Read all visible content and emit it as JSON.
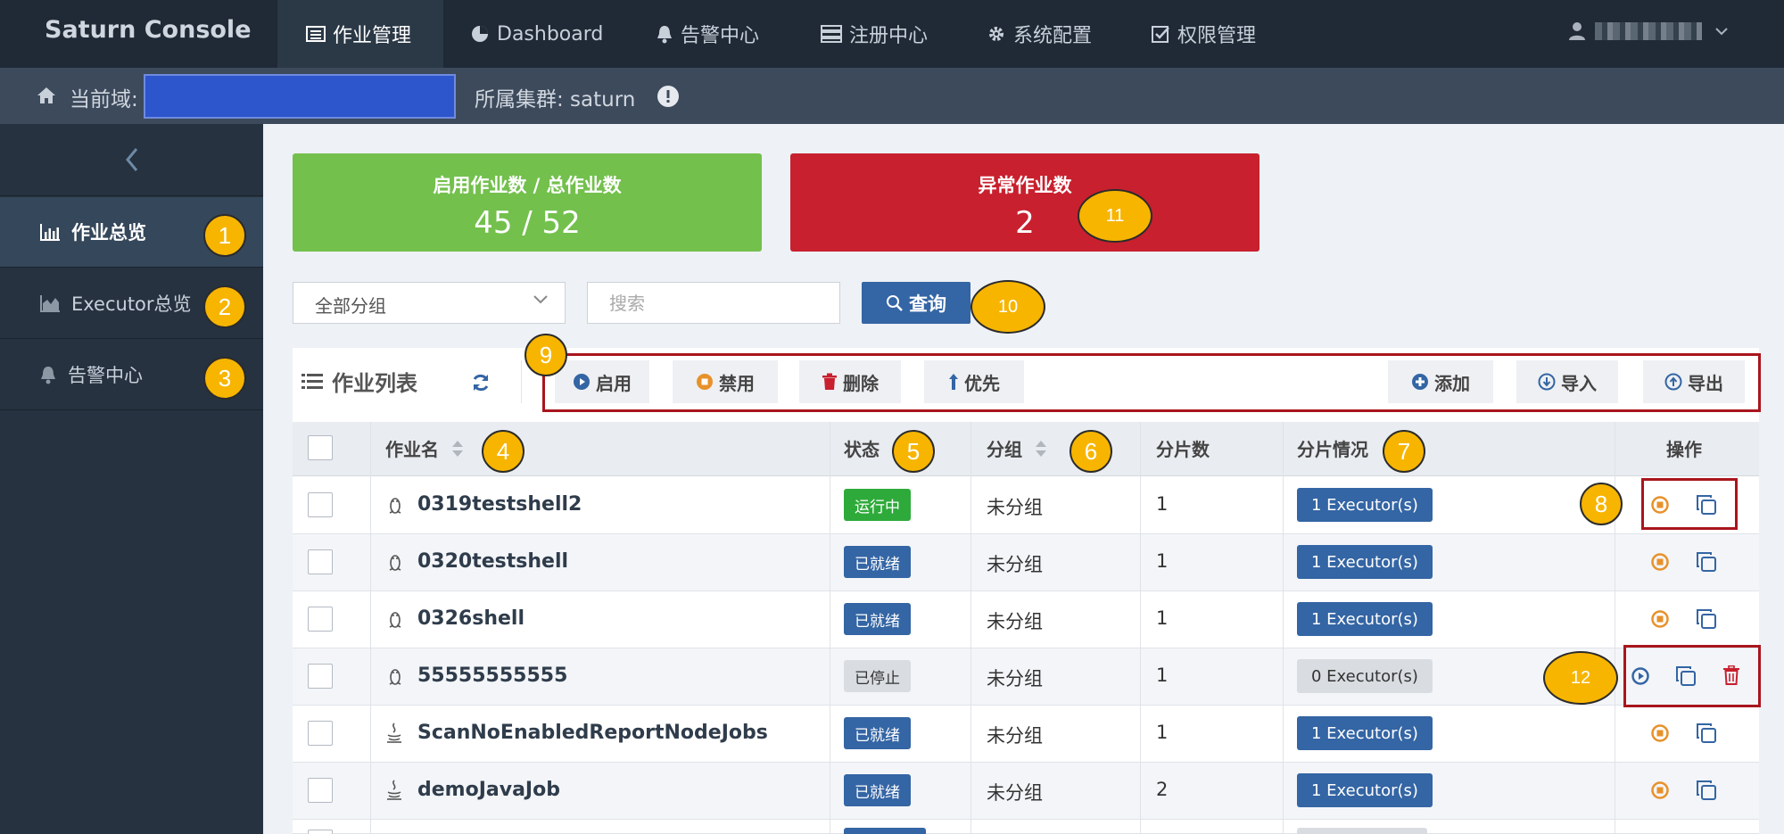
{
  "app": {
    "title": "Saturn Console"
  },
  "nav": {
    "tabs": [
      {
        "label": "作业管理",
        "icon": "list-icon",
        "active": true
      },
      {
        "label": "Dashboard",
        "icon": "pie-chart-icon"
      },
      {
        "label": "告警中心",
        "icon": "bell-icon"
      },
      {
        "label": "注册中心",
        "icon": "server-icon"
      },
      {
        "label": "系统配置",
        "icon": "gear-icon"
      },
      {
        "label": "权限管理",
        "icon": "checkbox-icon"
      }
    ]
  },
  "domain_bar": {
    "label": "当前域:",
    "cluster": "所属集群: saturn"
  },
  "sidebar": {
    "items": [
      {
        "label": "作业总览",
        "icon": "bar-chart-icon",
        "active": true
      },
      {
        "label": "Executor总览",
        "icon": "area-chart-icon"
      },
      {
        "label": "告警中心",
        "icon": "bell-icon"
      }
    ]
  },
  "stats": {
    "enabled": {
      "title": "启用作业数 / 总作业数",
      "value": "45 / 52"
    },
    "abnormal": {
      "title": "异常作业数",
      "value": "2"
    }
  },
  "filters": {
    "group_select": "全部分组",
    "search_placeholder": "搜索",
    "query_label": "查询"
  },
  "panel": {
    "title": "作业列表",
    "toolbar": {
      "enable": "启用",
      "disable": "禁用",
      "delete": "删除",
      "priority": "优先",
      "add": "添加",
      "import": "导入",
      "export": "导出"
    }
  },
  "table": {
    "headers": {
      "name": "作业名",
      "status": "状态",
      "group": "分组",
      "shards": "分片数",
      "shard_status": "分片情况",
      "ops": "操作"
    },
    "rows": [
      {
        "icon": "linux-icon",
        "name": "0319testshell2",
        "status": "运行中",
        "group": "未分组",
        "shards": "1",
        "executors": "1 Executor(s)"
      },
      {
        "icon": "linux-icon",
        "name": "0320testshell",
        "status": "已就绪",
        "group": "未分组",
        "shards": "1",
        "executors": "1 Executor(s)"
      },
      {
        "icon": "linux-icon",
        "name": "0326shell",
        "status": "已就绪",
        "group": "未分组",
        "shards": "1",
        "executors": "1 Executor(s)"
      },
      {
        "icon": "linux-icon",
        "name": "55555555555",
        "status": "已停止",
        "group": "未分组",
        "shards": "1",
        "executors": "0 Executor(s)"
      },
      {
        "icon": "java-icon",
        "name": "ScanNoEnabledReportNodeJobs",
        "status": "已就绪",
        "group": "未分组",
        "shards": "1",
        "executors": "1 Executor(s)"
      },
      {
        "icon": "java-icon",
        "name": "demoJavaJob",
        "status": "已就绪",
        "group": "未分组",
        "shards": "2",
        "executors": "1 Executor(s)"
      }
    ]
  },
  "callouts": [
    "1",
    "2",
    "3",
    "4",
    "5",
    "6",
    "7",
    "8",
    "9",
    "10",
    "11",
    "12"
  ],
  "colors": {
    "nav_bg": "#1f2a36",
    "sidebar_bg": "#263240",
    "green": "#73c04d",
    "red": "#c8202e",
    "blue": "#3465a4",
    "callout": "#f7b500"
  }
}
